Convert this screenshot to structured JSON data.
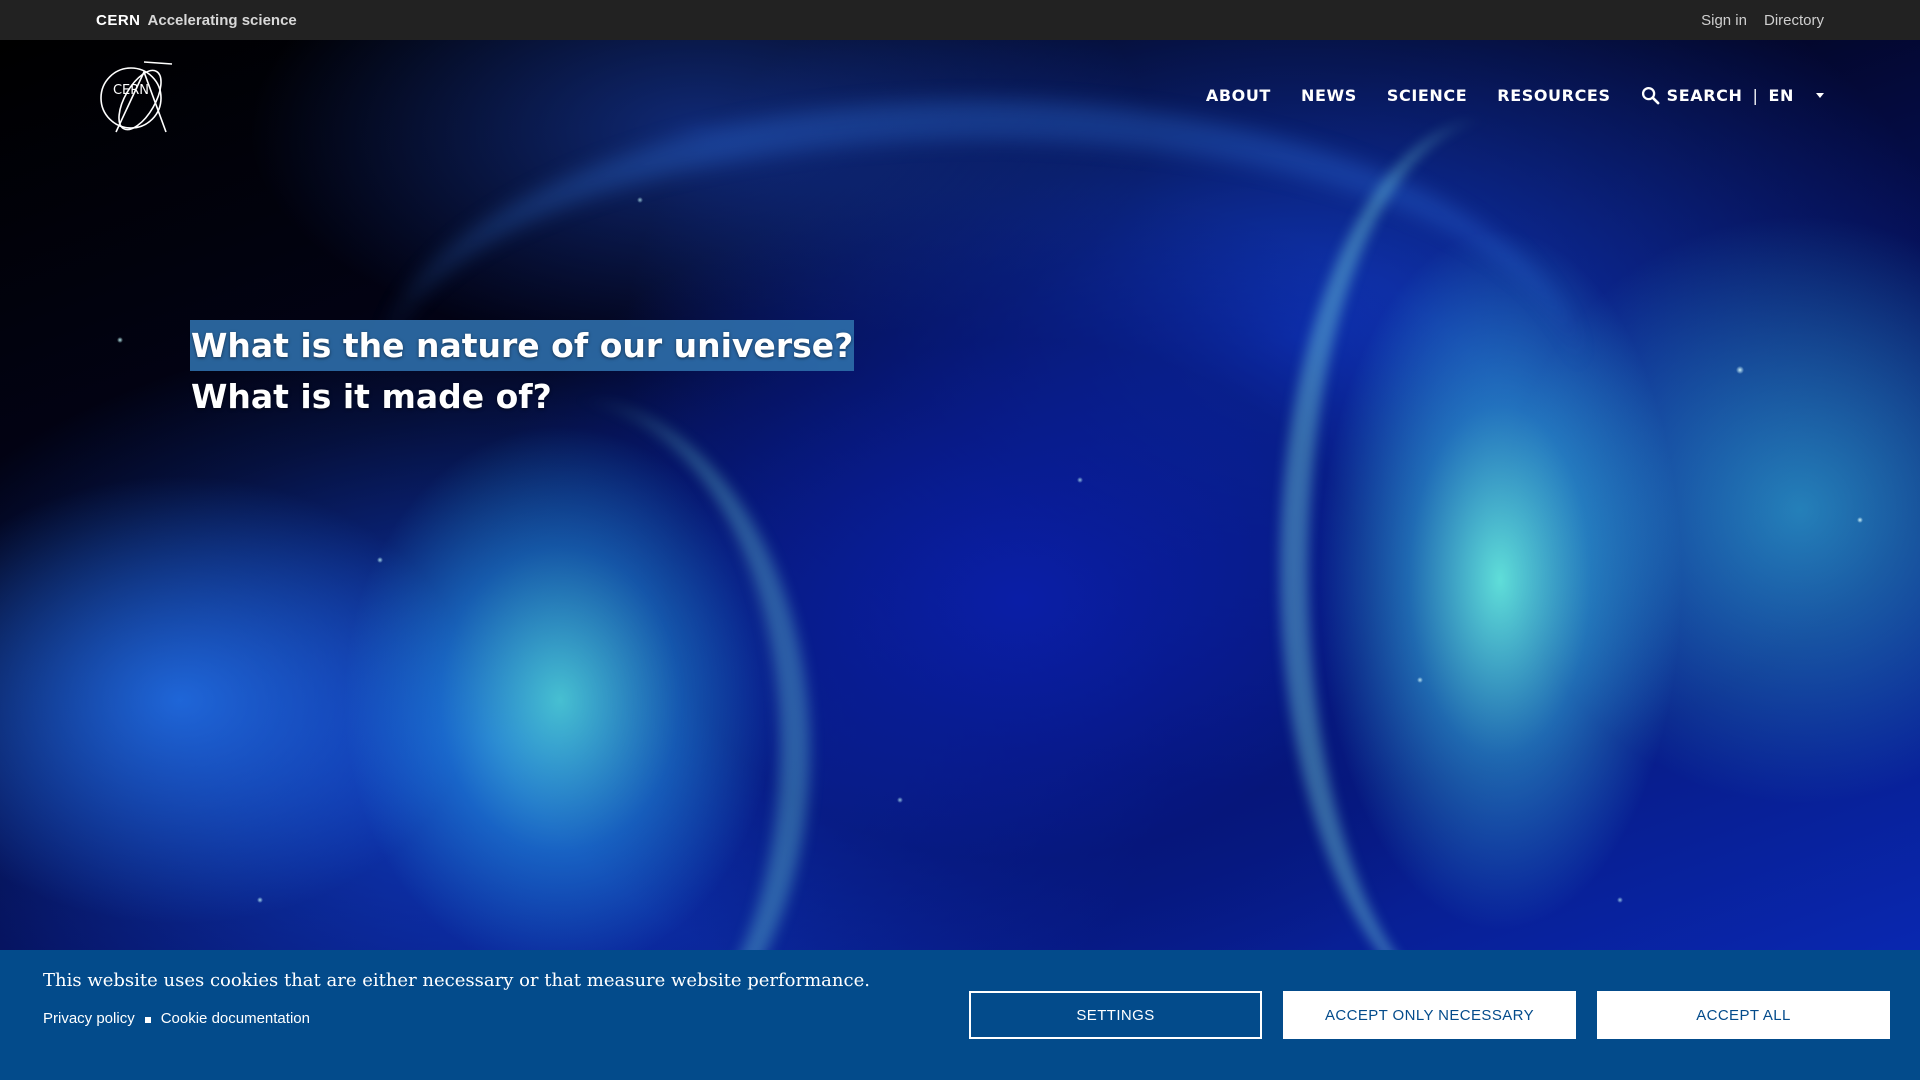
{
  "toolbar": {
    "org": "CERN",
    "tagline": "Accelerating science",
    "sign_in": "Sign in",
    "directory": "Directory"
  },
  "header": {
    "logo_icon": "cern-logo-icon",
    "nav": {
      "about": "ABOUT",
      "news": "NEWS",
      "science": "SCIENCE",
      "resources": "RESOURCES",
      "search": "SEARCH",
      "separator": "|",
      "language": "EN"
    }
  },
  "hero": {
    "line1": "What is the nature of our universe?",
    "line2": "What is it made of?"
  },
  "cookie": {
    "message": "This website uses cookies that are either necessary or that measure website performance.",
    "privacy_policy": "Privacy policy",
    "cookie_documentation": "Cookie documentation",
    "settings": "SETTINGS",
    "accept_necessary": "ACCEPT ONLY NECESSARY",
    "accept_all": "ACCEPT ALL"
  },
  "colors": {
    "toolbar_bg": "#222222",
    "banner_bg": "#034b8b",
    "selection_bg": "#2e6eaa"
  }
}
